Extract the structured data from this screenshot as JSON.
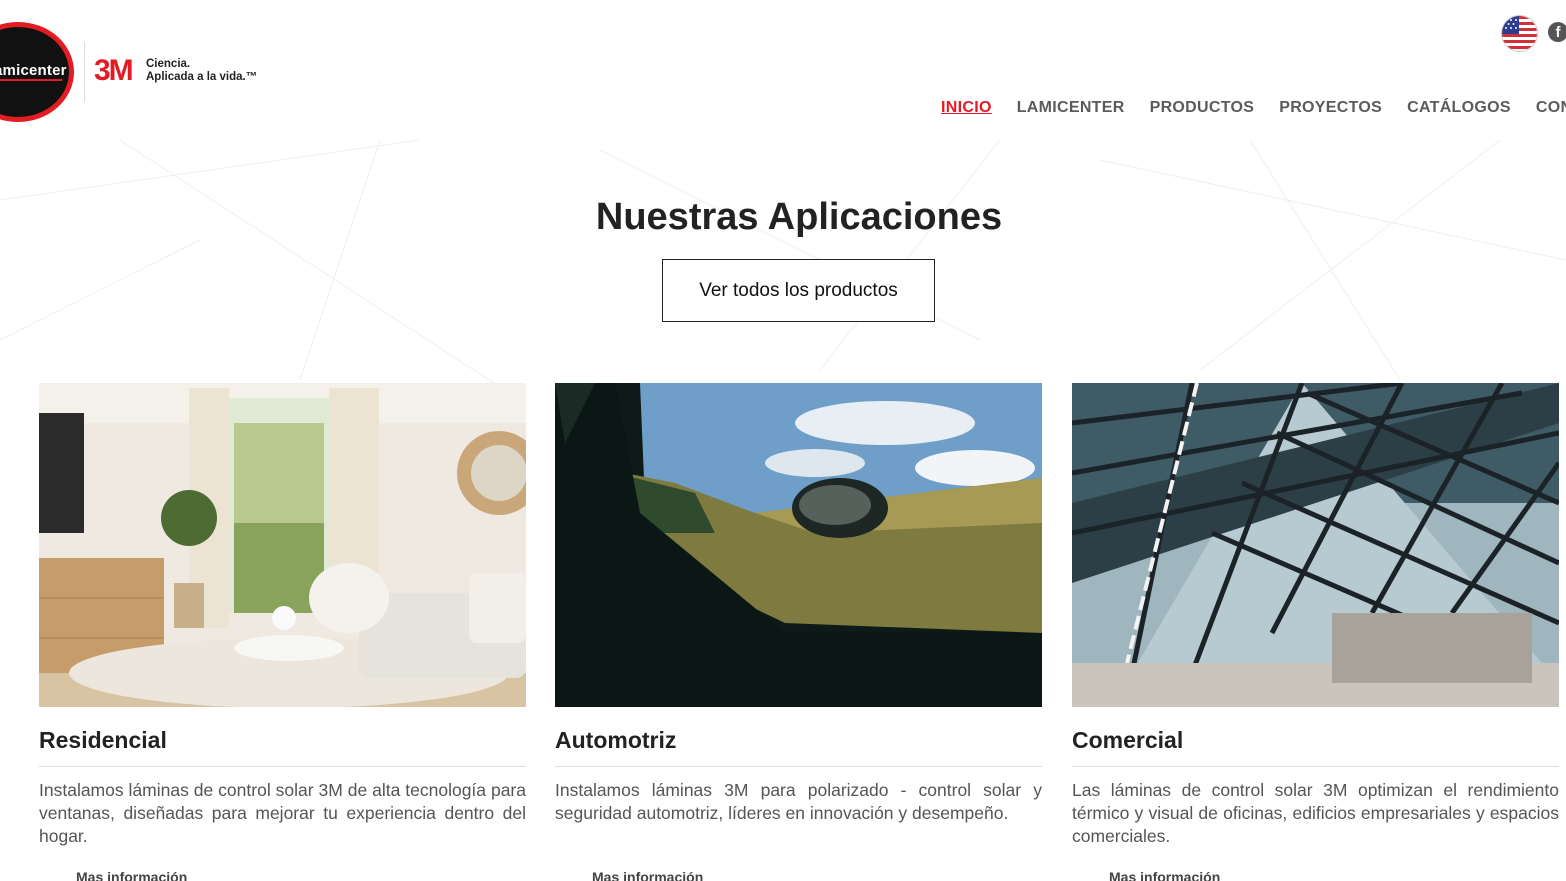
{
  "header": {
    "logo_text": "amicenter",
    "brand_mark": "3M",
    "brand_tagline_line1": "Ciencia.",
    "brand_tagline_line2": "Aplicada a la vida.™",
    "language_icon": "us-flag-icon",
    "social_icon": "facebook-icon",
    "social_glyph": "f"
  },
  "nav": {
    "items": [
      {
        "label": "INICIO",
        "active": true
      },
      {
        "label": "LAMICENTER",
        "active": false
      },
      {
        "label": "PRODUCTOS",
        "active": false
      },
      {
        "label": "PROYECTOS",
        "active": false
      },
      {
        "label": "CATÁLOGOS",
        "active": false
      },
      {
        "label": "CONTÁCTO",
        "active": false
      }
    ]
  },
  "main": {
    "title": "Nuestras Aplicaciones",
    "button_label": "Ver todos los productos",
    "cards": [
      {
        "title": "Residencial",
        "image": "living-room-photo",
        "text": "Instalamos láminas de control solar 3M de alta tecnología para ventanas, diseñadas para mejorar tu experiencia dentro del hogar.",
        "link": "Mas información"
      },
      {
        "title": "Automotriz",
        "image": "car-window-photo",
        "text": "Instalamos láminas 3M para polarizado - control solar y seguridad automotriz, líderes en innovación y desempeño.",
        "link": "Mas información"
      },
      {
        "title": "Comercial",
        "image": "glass-roof-photo",
        "text": "Las láminas de control solar 3M optimizan el rendimiento térmico y visual de oficinas, edificios empresariales y espacios comerciales.",
        "link": "Mas información"
      }
    ]
  },
  "colors": {
    "accent": "#e31b23",
    "nav_text": "#5b5b5b",
    "title_text": "#222222"
  }
}
